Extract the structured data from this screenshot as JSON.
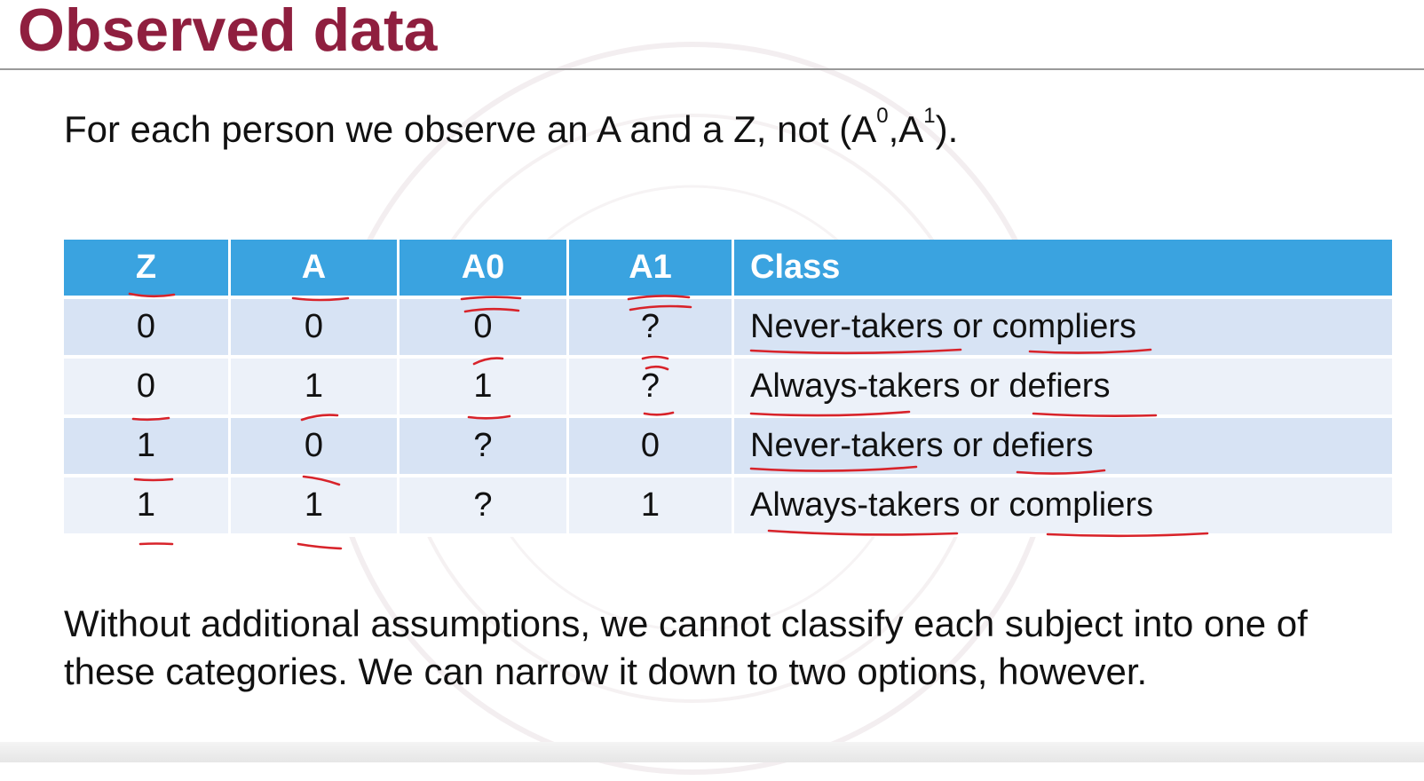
{
  "slide": {
    "title": "Observed data",
    "intro": {
      "text_before": "For each person we observe an A and a Z, not (A",
      "sup_0": "0",
      "comma": ",A",
      "sup_1": "1",
      "text_after": ")."
    },
    "table": {
      "headers": [
        "Z",
        "A",
        "A0",
        "A1",
        "Class"
      ],
      "rows": [
        [
          "0",
          "0",
          "0",
          "?",
          "Never-takers or compliers"
        ],
        [
          "0",
          "1",
          "1",
          "?",
          "Always-takers or defiers"
        ],
        [
          "1",
          "0",
          "?",
          "0",
          "Never-takers or defiers"
        ],
        [
          "1",
          "1",
          "?",
          "1",
          "Always-takers or compliers"
        ]
      ]
    },
    "closing": "Without additional assumptions, we cannot classify each subject into one of these categories. We can narrow it down to two options, however.",
    "colors": {
      "title": "#8f1f3f",
      "header_bg": "#3aa3e0",
      "row_dark": "#d7e3f4",
      "row_light": "#ecf1f9",
      "annotation_ink": "#d8232a"
    }
  }
}
